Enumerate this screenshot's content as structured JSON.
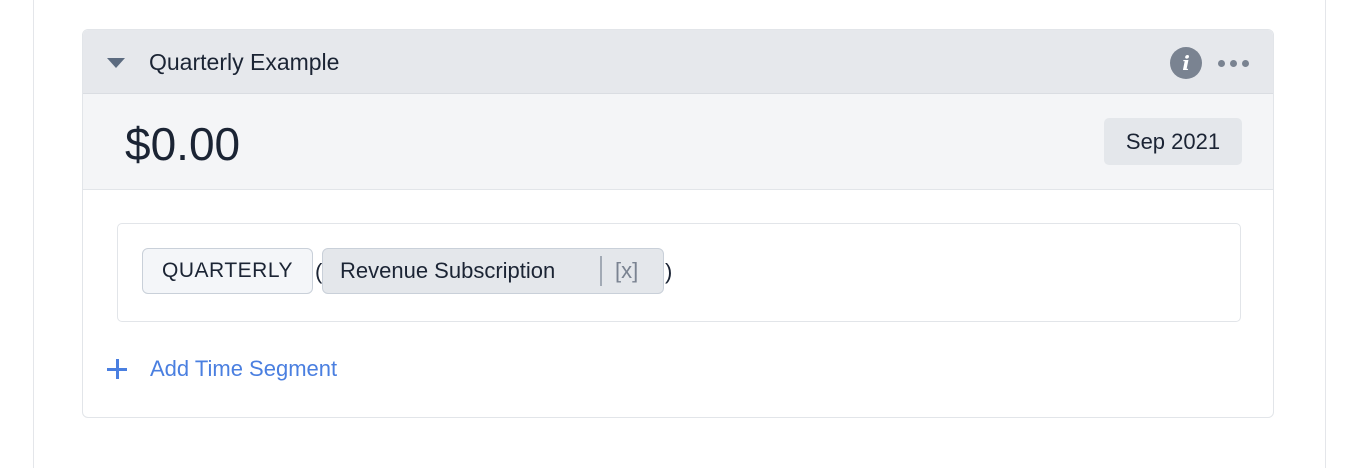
{
  "card": {
    "title": "Quarterly Example",
    "amount": "$0.00",
    "period": "Sep 2021"
  },
  "formula": {
    "function_name": "QUARTERLY",
    "open_paren": "(",
    "close_paren": ")",
    "argument": "Revenue Subscription",
    "remove_label": "[x]"
  },
  "actions": {
    "add_time_segment": "Add Time Segment"
  },
  "icons": {
    "collapse": "caret-down-icon",
    "info": "info-icon",
    "more": "more-horizontal-icon",
    "add": "plus-icon"
  },
  "colors": {
    "header_bg": "#e6e8ec",
    "summary_bg": "#f4f5f7",
    "accent": "#4a7fe0",
    "text": "#1b2434",
    "icon": "#7a8391"
  }
}
